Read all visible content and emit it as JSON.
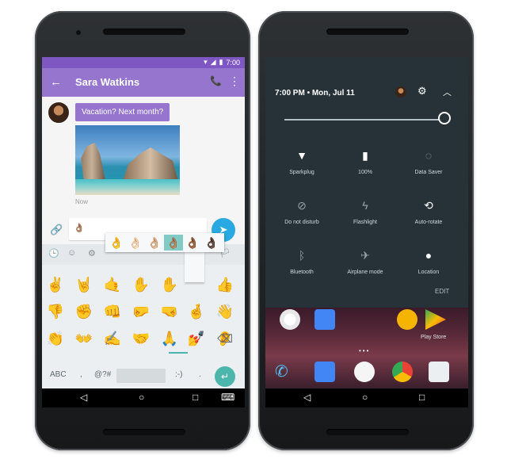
{
  "left_phone": {
    "status_time": "7:00",
    "contact_name": "Sara Watkins",
    "message_text": "Vacation? Next month?",
    "timestamp": "Now",
    "input_value": "👌🏽",
    "emoji_categories": [
      "🕒",
      "☺",
      "⚙",
      "🏳"
    ],
    "skin_tones": [
      "👌",
      "👌🏻",
      "👌🏼",
      "👌🏽",
      "👌🏾",
      "👌🏿"
    ],
    "emoji_rows": [
      [
        "✌",
        "🤘",
        "🤙",
        "✋",
        "✋",
        "👍"
      ],
      [
        "👎",
        "✊",
        "👊",
        "🤛",
        "🤜",
        "🤞",
        "👋"
      ],
      [
        "👏",
        "👐",
        "✍",
        "🤝",
        "🙏",
        "💅",
        "👂"
      ]
    ],
    "keyboard": {
      "abc": "ABC",
      "comma": ",",
      "symbols": "@?#",
      "smiley": ":-)",
      "period": "."
    }
  },
  "right_phone": {
    "time_date": "7:00 PM • Mon, Jul 11",
    "tiles": [
      {
        "label": "Sparkplug",
        "icon": "wifi-icon"
      },
      {
        "label": "100%",
        "icon": "battery-icon"
      },
      {
        "label": "Data Saver",
        "icon": "data-saver-icon"
      },
      {
        "label": "Do not disturb",
        "icon": "dnd-icon"
      },
      {
        "label": "Flashlight",
        "icon": "flashlight-icon"
      },
      {
        "label": "Auto-rotate",
        "icon": "autorotate-icon"
      },
      {
        "label": "Bluetooth",
        "icon": "bluetooth-icon"
      },
      {
        "label": "Airplane mode",
        "icon": "airplane-icon"
      },
      {
        "label": "Location",
        "icon": "location-icon"
      }
    ],
    "edit_label": "EDIT",
    "play_store_label": "Play Store"
  },
  "colors": {
    "accent_purple": "#9575cd",
    "status_purple": "#7e57c2",
    "send_blue": "#29a9e1",
    "teal": "#4db6ac",
    "qs_background": "#263238"
  }
}
